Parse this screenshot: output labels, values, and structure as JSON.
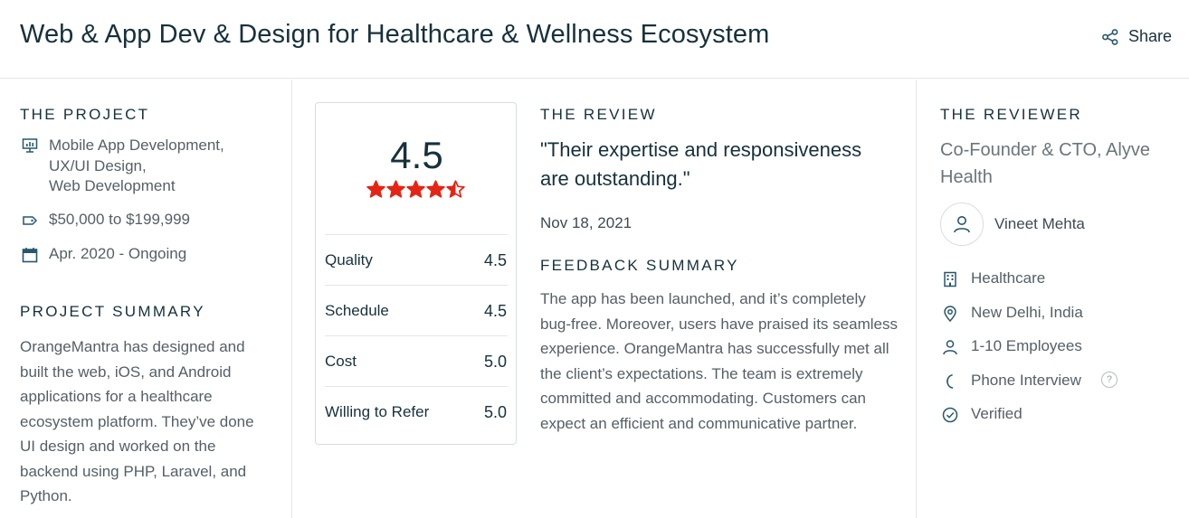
{
  "header": {
    "title": "Web & App Dev & Design for Healthcare & Wellness Ecosystem",
    "share_label": "Share"
  },
  "project": {
    "heading": "THE PROJECT",
    "services": [
      "Mobile App Development,",
      "UX/UI Design,",
      "Web Development"
    ],
    "budget": "$50,000 to $199,999",
    "dates": "Apr. 2020 - Ongoing",
    "summary_heading": "PROJECT SUMMARY",
    "summary": "OrangeMantra has designed and built the web, iOS, and Android applications for a healthcare ecosystem platform. They’ve done UI design and worked on the backend using PHP, Laravel, and Python."
  },
  "rating": {
    "overall": "4.5",
    "stars_value": 4.5,
    "star_color": "#e62415",
    "rows": [
      {
        "label": "Quality",
        "value": "4.5"
      },
      {
        "label": "Schedule",
        "value": "4.5"
      },
      {
        "label": "Cost",
        "value": "5.0"
      },
      {
        "label": "Willing to Refer",
        "value": "5.0"
      }
    ]
  },
  "review": {
    "heading": "THE REVIEW",
    "quote": "\"Their expertise and responsiveness are outstanding.\"",
    "date": "Nov 18, 2021",
    "feedback_heading": "FEEDBACK SUMMARY",
    "feedback": "The app has been launched, and it’s completely bug-free. Moreover, users have praised its seamless experience. OrangeMantra has successfully met all the client’s expectations. The team is extremely committed and accommodating. Customers can expect an efficient and communicative partner."
  },
  "reviewer": {
    "heading": "THE REVIEWER",
    "title": "Co-Founder & CTO, Alyve Health",
    "name": "Vineet Mehta",
    "industry": "Healthcare",
    "location": "New Delhi, India",
    "size": "1-10 Employees",
    "interview": "Phone Interview",
    "help_glyph": "?",
    "verified": "Verified"
  },
  "icons": [
    "share-icon",
    "presentation-icon",
    "price-tag-icon",
    "calendar-icon",
    "star-icon",
    "user-icon",
    "building-icon",
    "location-pin-icon",
    "people-icon",
    "phone-icon",
    "check-circle-icon"
  ]
}
